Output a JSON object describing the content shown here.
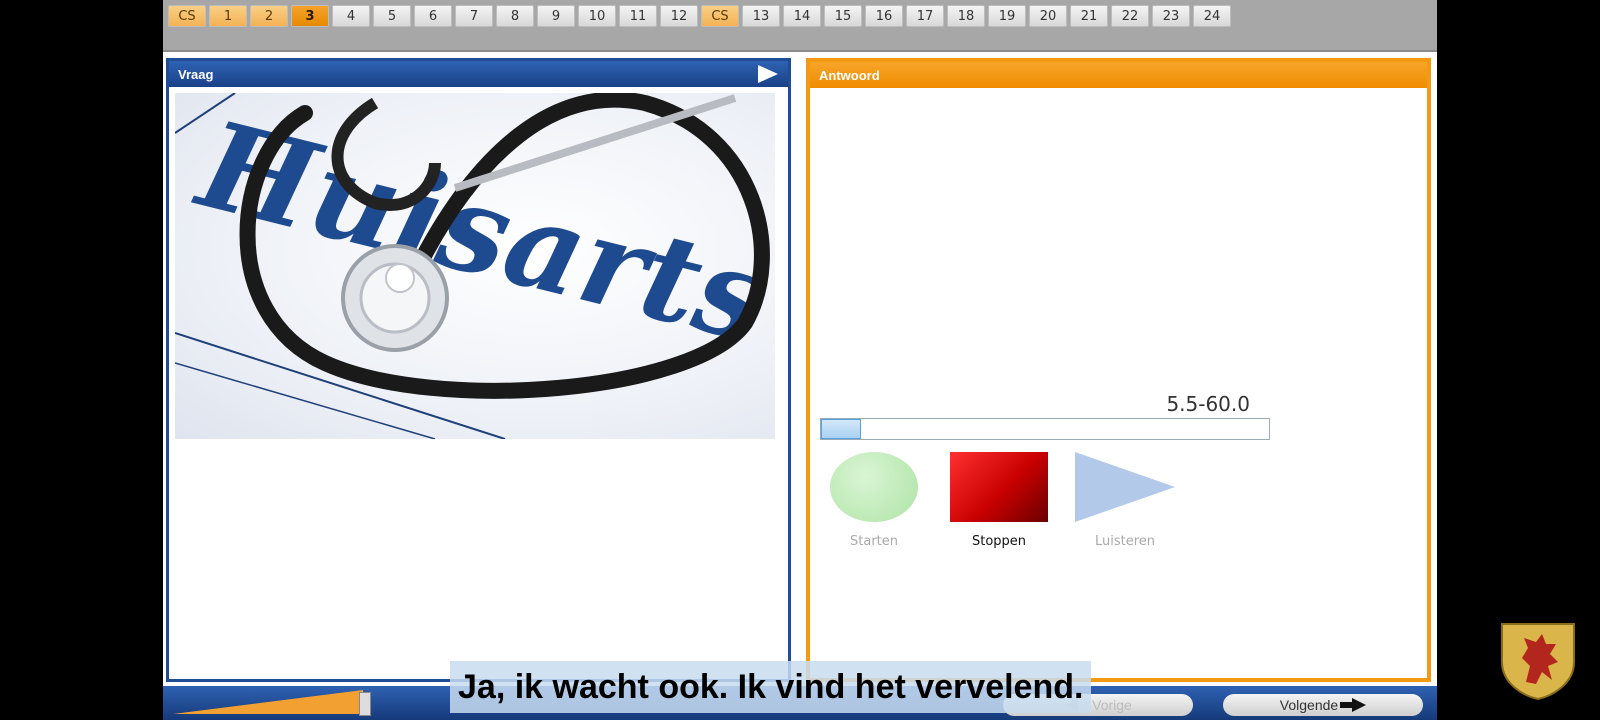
{
  "nav": {
    "items": [
      {
        "label": "CS",
        "state": "cs"
      },
      {
        "label": "1",
        "state": "done"
      },
      {
        "label": "2",
        "state": "done"
      },
      {
        "label": "3",
        "state": "active"
      },
      {
        "label": "4",
        "state": ""
      },
      {
        "label": "5",
        "state": ""
      },
      {
        "label": "6",
        "state": ""
      },
      {
        "label": "7",
        "state": ""
      },
      {
        "label": "8",
        "state": ""
      },
      {
        "label": "9",
        "state": ""
      },
      {
        "label": "10",
        "state": ""
      },
      {
        "label": "11",
        "state": ""
      },
      {
        "label": "12",
        "state": ""
      },
      {
        "label": "CS",
        "state": "cs"
      },
      {
        "label": "13",
        "state": ""
      },
      {
        "label": "14",
        "state": ""
      },
      {
        "label": "15",
        "state": ""
      },
      {
        "label": "16",
        "state": ""
      },
      {
        "label": "17",
        "state": ""
      },
      {
        "label": "18",
        "state": ""
      },
      {
        "label": "19",
        "state": ""
      },
      {
        "label": "20",
        "state": ""
      },
      {
        "label": "21",
        "state": ""
      },
      {
        "label": "22",
        "state": ""
      },
      {
        "label": "23",
        "state": ""
      },
      {
        "label": "24",
        "state": ""
      }
    ]
  },
  "question": {
    "title": "Vraag",
    "image_word": "Huisarts"
  },
  "answer": {
    "title": "Antwoord",
    "timer": "5.5-60.0",
    "progress_percent": 9,
    "start_label": "Starten",
    "stop_label": "Stoppen",
    "listen_label": "Luisteren"
  },
  "footer": {
    "prev_label": "Vorige",
    "next_label": "Volgende",
    "volume_percent": 100
  },
  "subtitle": "Ja, ik wacht ook. Ik vind het vervelend.",
  "colors": {
    "blue": "#1f4e97",
    "orange": "#f39a12"
  }
}
